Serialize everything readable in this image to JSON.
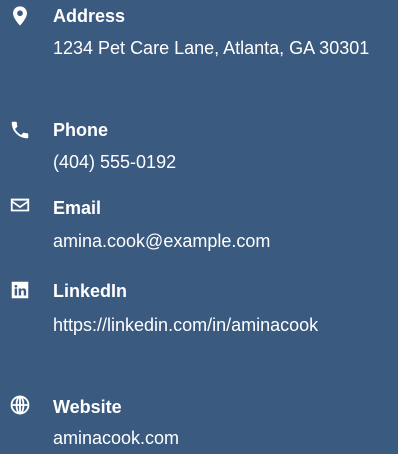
{
  "contact": {
    "address": {
      "label": "Address",
      "value": "1234 Pet Care Lane, Atlanta, GA 30301",
      "icon": "map-pin-icon"
    },
    "phone": {
      "label": "Phone",
      "value": "(404) 555-0192",
      "icon": "phone-icon"
    },
    "email": {
      "label": "Email",
      "value": "amina.cook@example.com",
      "icon": "envelope-icon"
    },
    "linkedin": {
      "label": "LinkedIn",
      "value": "https://linkedin.com/in/aminacook",
      "icon": "linkedin-icon"
    },
    "website": {
      "label": "Website",
      "value": "aminacook.com",
      "icon": "globe-icon"
    }
  },
  "colors": {
    "background": "#3a5a80",
    "text": "#ffffff"
  }
}
